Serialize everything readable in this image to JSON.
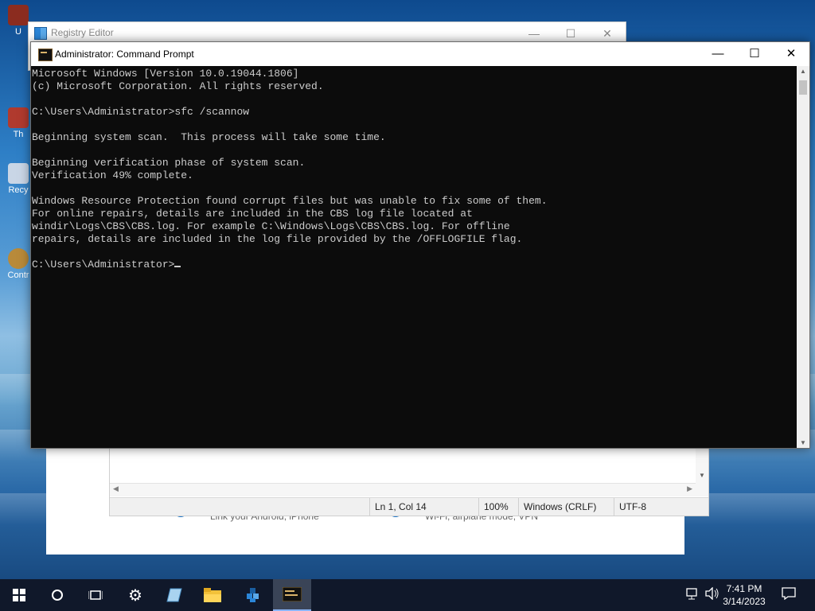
{
  "desktop": {
    "icons": [
      {
        "name": "icon-1",
        "label": "U"
      },
      {
        "name": "icon-2",
        "label": "Th"
      },
      {
        "name": "icon-3",
        "label": "Recy"
      },
      {
        "name": "icon-4",
        "label": "Contr"
      }
    ]
  },
  "settings_bg": {
    "link_text": "Link your Android, iPhone",
    "network_text": "Wi-Fi, airplane mode, VPN"
  },
  "notepad": {
    "status": {
      "position": "Ln 1, Col 14",
      "zoom": "100%",
      "line_ending": "Windows (CRLF)",
      "encoding": "UTF-8"
    }
  },
  "regedit": {
    "title": "Registry Editor"
  },
  "cmd": {
    "title": "Administrator: Command Prompt",
    "lines": [
      "Microsoft Windows [Version 10.0.19044.1806]",
      "(c) Microsoft Corporation. All rights reserved.",
      "",
      "C:\\Users\\Administrator>sfc /scannow",
      "",
      "Beginning system scan.  This process will take some time.",
      "",
      "Beginning verification phase of system scan.",
      "Verification 49% complete.",
      "",
      "Windows Resource Protection found corrupt files but was unable to fix some of them.",
      "For online repairs, details are included in the CBS log file located at",
      "windir\\Logs\\CBS\\CBS.log. For example C:\\Windows\\Logs\\CBS\\CBS.log. For offline",
      "repairs, details are included in the log file provided by the /OFFLOGFILE flag.",
      ""
    ],
    "prompt": "C:\\Users\\Administrator>"
  },
  "window_controls": {
    "minimize": "—",
    "maximize": "☐",
    "close": "✕"
  },
  "taskbar": {
    "time": "7:41 PM",
    "date": "3/14/2023",
    "buttons": [
      "start-icon",
      "search-icon",
      "task-view-icon",
      "settings-icon",
      "notepad-icon",
      "file-explorer-icon",
      "registry-editor-icon",
      "command-prompt-icon"
    ]
  }
}
